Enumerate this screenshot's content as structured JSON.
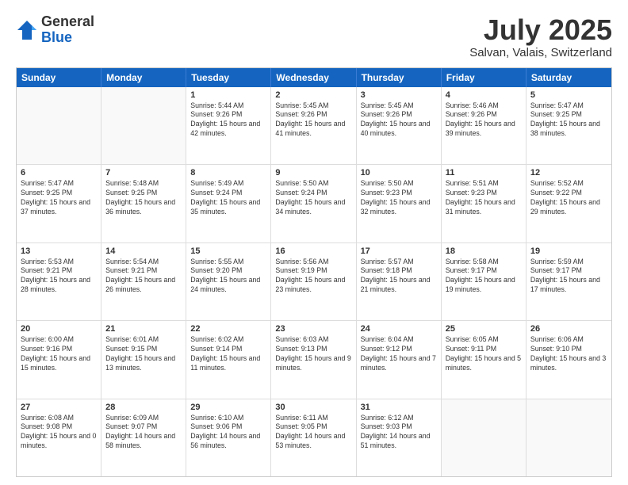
{
  "logo": {
    "general": "General",
    "blue": "Blue"
  },
  "header": {
    "month": "July 2025",
    "location": "Salvan, Valais, Switzerland"
  },
  "weekdays": [
    "Sunday",
    "Monday",
    "Tuesday",
    "Wednesday",
    "Thursday",
    "Friday",
    "Saturday"
  ],
  "weeks": [
    [
      {
        "day": "",
        "sunrise": "",
        "sunset": "",
        "daylight": ""
      },
      {
        "day": "",
        "sunrise": "",
        "sunset": "",
        "daylight": ""
      },
      {
        "day": "1",
        "sunrise": "Sunrise: 5:44 AM",
        "sunset": "Sunset: 9:26 PM",
        "daylight": "Daylight: 15 hours and 42 minutes."
      },
      {
        "day": "2",
        "sunrise": "Sunrise: 5:45 AM",
        "sunset": "Sunset: 9:26 PM",
        "daylight": "Daylight: 15 hours and 41 minutes."
      },
      {
        "day": "3",
        "sunrise": "Sunrise: 5:45 AM",
        "sunset": "Sunset: 9:26 PM",
        "daylight": "Daylight: 15 hours and 40 minutes."
      },
      {
        "day": "4",
        "sunrise": "Sunrise: 5:46 AM",
        "sunset": "Sunset: 9:26 PM",
        "daylight": "Daylight: 15 hours and 39 minutes."
      },
      {
        "day": "5",
        "sunrise": "Sunrise: 5:47 AM",
        "sunset": "Sunset: 9:25 PM",
        "daylight": "Daylight: 15 hours and 38 minutes."
      }
    ],
    [
      {
        "day": "6",
        "sunrise": "Sunrise: 5:47 AM",
        "sunset": "Sunset: 9:25 PM",
        "daylight": "Daylight: 15 hours and 37 minutes."
      },
      {
        "day": "7",
        "sunrise": "Sunrise: 5:48 AM",
        "sunset": "Sunset: 9:25 PM",
        "daylight": "Daylight: 15 hours and 36 minutes."
      },
      {
        "day": "8",
        "sunrise": "Sunrise: 5:49 AM",
        "sunset": "Sunset: 9:24 PM",
        "daylight": "Daylight: 15 hours and 35 minutes."
      },
      {
        "day": "9",
        "sunrise": "Sunrise: 5:50 AM",
        "sunset": "Sunset: 9:24 PM",
        "daylight": "Daylight: 15 hours and 34 minutes."
      },
      {
        "day": "10",
        "sunrise": "Sunrise: 5:50 AM",
        "sunset": "Sunset: 9:23 PM",
        "daylight": "Daylight: 15 hours and 32 minutes."
      },
      {
        "day": "11",
        "sunrise": "Sunrise: 5:51 AM",
        "sunset": "Sunset: 9:23 PM",
        "daylight": "Daylight: 15 hours and 31 minutes."
      },
      {
        "day": "12",
        "sunrise": "Sunrise: 5:52 AM",
        "sunset": "Sunset: 9:22 PM",
        "daylight": "Daylight: 15 hours and 29 minutes."
      }
    ],
    [
      {
        "day": "13",
        "sunrise": "Sunrise: 5:53 AM",
        "sunset": "Sunset: 9:21 PM",
        "daylight": "Daylight: 15 hours and 28 minutes."
      },
      {
        "day": "14",
        "sunrise": "Sunrise: 5:54 AM",
        "sunset": "Sunset: 9:21 PM",
        "daylight": "Daylight: 15 hours and 26 minutes."
      },
      {
        "day": "15",
        "sunrise": "Sunrise: 5:55 AM",
        "sunset": "Sunset: 9:20 PM",
        "daylight": "Daylight: 15 hours and 24 minutes."
      },
      {
        "day": "16",
        "sunrise": "Sunrise: 5:56 AM",
        "sunset": "Sunset: 9:19 PM",
        "daylight": "Daylight: 15 hours and 23 minutes."
      },
      {
        "day": "17",
        "sunrise": "Sunrise: 5:57 AM",
        "sunset": "Sunset: 9:18 PM",
        "daylight": "Daylight: 15 hours and 21 minutes."
      },
      {
        "day": "18",
        "sunrise": "Sunrise: 5:58 AM",
        "sunset": "Sunset: 9:17 PM",
        "daylight": "Daylight: 15 hours and 19 minutes."
      },
      {
        "day": "19",
        "sunrise": "Sunrise: 5:59 AM",
        "sunset": "Sunset: 9:17 PM",
        "daylight": "Daylight: 15 hours and 17 minutes."
      }
    ],
    [
      {
        "day": "20",
        "sunrise": "Sunrise: 6:00 AM",
        "sunset": "Sunset: 9:16 PM",
        "daylight": "Daylight: 15 hours and 15 minutes."
      },
      {
        "day": "21",
        "sunrise": "Sunrise: 6:01 AM",
        "sunset": "Sunset: 9:15 PM",
        "daylight": "Daylight: 15 hours and 13 minutes."
      },
      {
        "day": "22",
        "sunrise": "Sunrise: 6:02 AM",
        "sunset": "Sunset: 9:14 PM",
        "daylight": "Daylight: 15 hours and 11 minutes."
      },
      {
        "day": "23",
        "sunrise": "Sunrise: 6:03 AM",
        "sunset": "Sunset: 9:13 PM",
        "daylight": "Daylight: 15 hours and 9 minutes."
      },
      {
        "day": "24",
        "sunrise": "Sunrise: 6:04 AM",
        "sunset": "Sunset: 9:12 PM",
        "daylight": "Daylight: 15 hours and 7 minutes."
      },
      {
        "day": "25",
        "sunrise": "Sunrise: 6:05 AM",
        "sunset": "Sunset: 9:11 PM",
        "daylight": "Daylight: 15 hours and 5 minutes."
      },
      {
        "day": "26",
        "sunrise": "Sunrise: 6:06 AM",
        "sunset": "Sunset: 9:10 PM",
        "daylight": "Daylight: 15 hours and 3 minutes."
      }
    ],
    [
      {
        "day": "27",
        "sunrise": "Sunrise: 6:08 AM",
        "sunset": "Sunset: 9:08 PM",
        "daylight": "Daylight: 15 hours and 0 minutes."
      },
      {
        "day": "28",
        "sunrise": "Sunrise: 6:09 AM",
        "sunset": "Sunset: 9:07 PM",
        "daylight": "Daylight: 14 hours and 58 minutes."
      },
      {
        "day": "29",
        "sunrise": "Sunrise: 6:10 AM",
        "sunset": "Sunset: 9:06 PM",
        "daylight": "Daylight: 14 hours and 56 minutes."
      },
      {
        "day": "30",
        "sunrise": "Sunrise: 6:11 AM",
        "sunset": "Sunset: 9:05 PM",
        "daylight": "Daylight: 14 hours and 53 minutes."
      },
      {
        "day": "31",
        "sunrise": "Sunrise: 6:12 AM",
        "sunset": "Sunset: 9:03 PM",
        "daylight": "Daylight: 14 hours and 51 minutes."
      },
      {
        "day": "",
        "sunrise": "",
        "sunset": "",
        "daylight": ""
      },
      {
        "day": "",
        "sunrise": "",
        "sunset": "",
        "daylight": ""
      }
    ]
  ]
}
